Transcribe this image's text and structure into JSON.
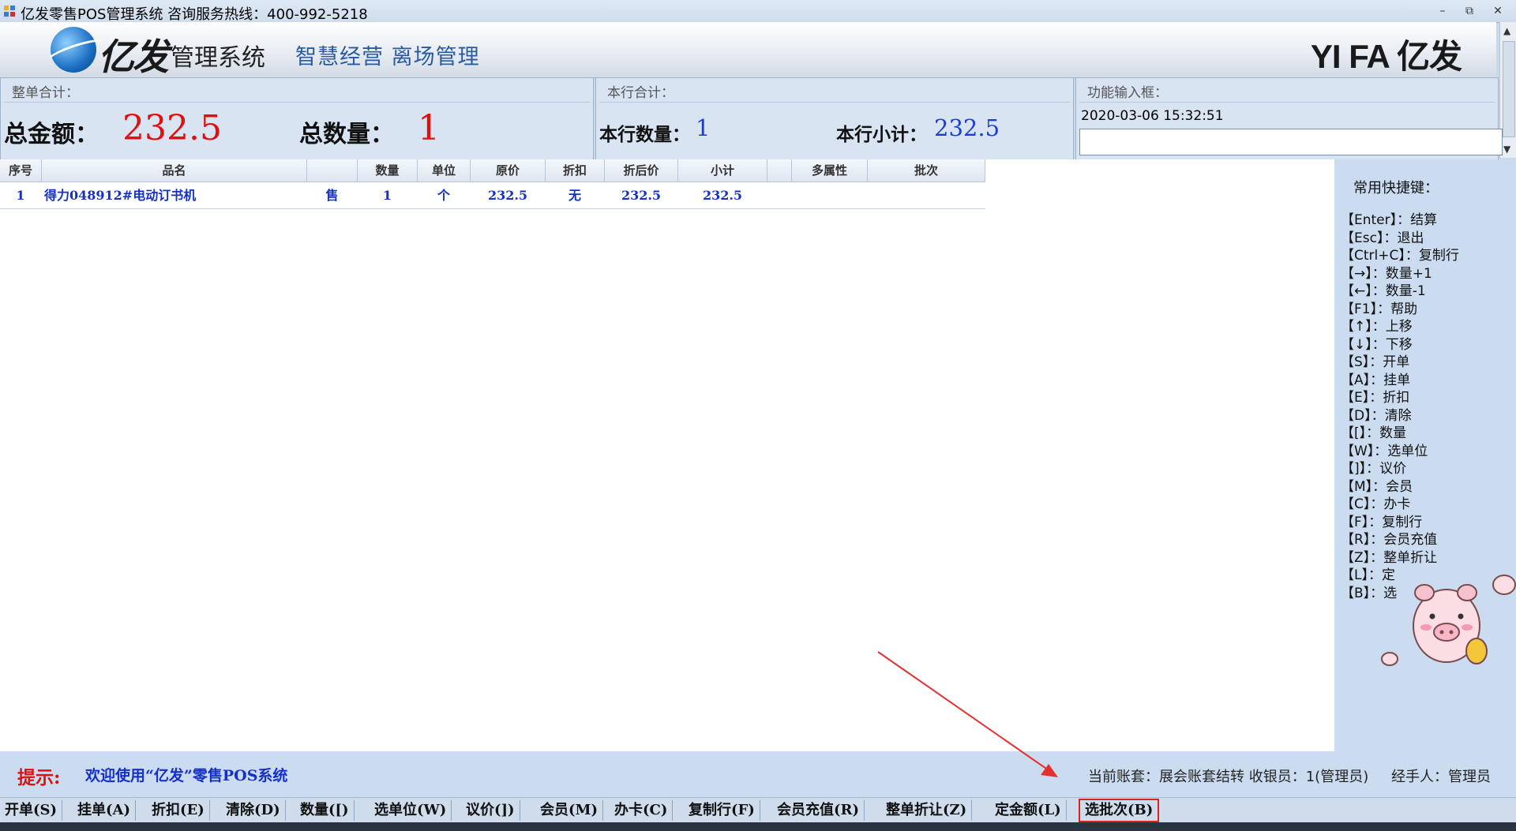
{
  "window": {
    "title": "亿发零售POS管理系统 咨询服务热线：400-992-5218",
    "controls": [
      "–",
      "⧉",
      "✕"
    ]
  },
  "header": {
    "brand": "亿发",
    "system": "管理系统",
    "slogan": "智慧经营  离场管理",
    "right_logo": "YI FA 亿发"
  },
  "panels": {
    "order_total": {
      "label": "整单合计：",
      "amount_label": "总金额：",
      "amount_value": "232.5",
      "qty_label": "总数量：",
      "qty_value": "1"
    },
    "line_total": {
      "label": "本行合计：",
      "qty_label": "本行数量：",
      "qty_value": "1",
      "subtotal_label": "本行小计：",
      "subtotal_value": "232.5"
    },
    "function_input": {
      "label": "功能输入框：",
      "datetime": "2020-03-06 15:32:51",
      "value": ""
    }
  },
  "grid": {
    "columns": [
      "序号",
      "品名",
      "",
      "数量",
      "单位",
      "原价",
      "折扣",
      "折后价",
      "小计",
      "",
      "多属性",
      "批次"
    ],
    "rows": [
      [
        "1",
        "得力048912#电动订书机",
        "售",
        "1",
        "个",
        "232.5",
        "无",
        "232.5",
        "232.5",
        "",
        "",
        ""
      ]
    ]
  },
  "shortcuts": {
    "title": "常用快捷键：",
    "items": [
      "【Enter】：结算",
      "【Esc】：退出",
      "【Ctrl+C】：复制行",
      "【→】：数量+1",
      "【←】：数量-1",
      "【F1】：帮助",
      "【↑】：上移",
      "【↓】：下移",
      "【S】：开单",
      "【A】：挂单",
      "【E】：折扣",
      "【D】：清除",
      "【[】：数量",
      "【W】：选单位",
      "【]】：议价",
      "【M】：会员",
      "【C】：办卡",
      "【F】：复制行",
      "【R】：会员充值",
      "【Z】：整单折让",
      "【L】：定",
      "【B】：选"
    ]
  },
  "status": {
    "tip_label": "提示:",
    "tip_message": "欢迎使用“亿发”零售POS系统",
    "account": "当前账套：展会账套结转 收银员：1(管理员)",
    "handler": "经手人：管理员"
  },
  "toolbar": {
    "buttons": [
      "开单(S)",
      "挂单(A)",
      "折扣(E)",
      "清除(D)",
      "数量([)",
      "选单位(W)",
      "议价(])",
      "会员(M)",
      "办卡(C)",
      "复制行(F)",
      "会员充值(R)",
      "整单折让(Z)",
      "定金额(L)",
      "选批次(B)"
    ]
  },
  "colors": {
    "total_red": "#e01010",
    "value_blue": "#1a3fd0",
    "highlight_box": "#e02020",
    "arrow": "#e53030"
  }
}
